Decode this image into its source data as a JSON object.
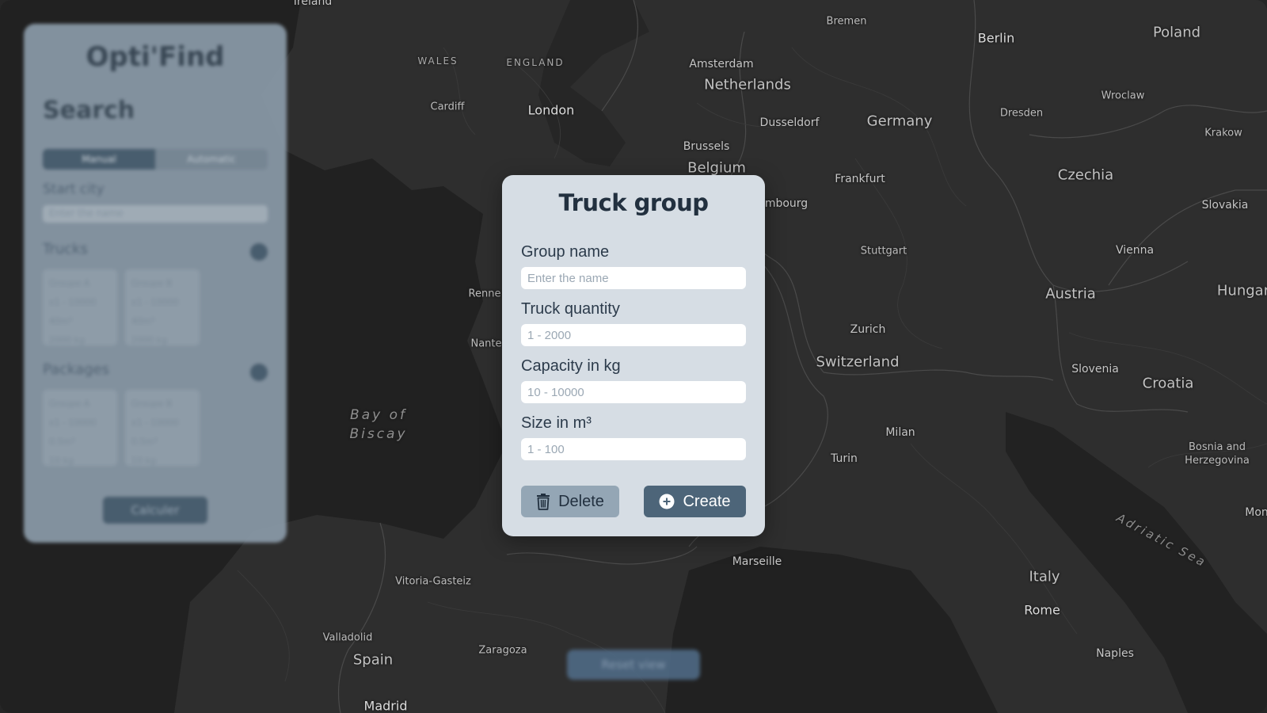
{
  "colors": {
    "map_background": "#2b2b2b",
    "modal_background": "#d6dde4",
    "primary_button": "#4d6579",
    "secondary_button": "#94a6b5",
    "title_text": "#22303f"
  },
  "map": {
    "labels": {
      "ireland": "Ireland",
      "wales": "WALES",
      "england": "ENGLAND",
      "cardiff": "Cardiff",
      "london": "London",
      "amsterdam": "Amsterdam",
      "netherlands": "Netherlands",
      "bremen": "Bremen",
      "berlin": "Berlin",
      "poland": "Poland",
      "wroclaw": "Wroclaw",
      "dresden": "Dresden",
      "krakow": "Krakow",
      "dusseldorf": "Dusseldorf",
      "germany": "Germany",
      "brussels": "Brussels",
      "belgium": "Belgium",
      "frankfurt": "Frankfurt",
      "luxembourg_partial": "mbourg",
      "czechia": "Czechia",
      "slovakia": "Slovakia",
      "stuttgart": "Stuttgart",
      "vienna": "Vienna",
      "hungary_partial": "Hungar",
      "rennes_partial": "Renne",
      "austria": "Austria",
      "zurich": "Zurich",
      "nantes_partial": "Nante",
      "switzerland": "Switzerland",
      "slovenia": "Slovenia",
      "croatia": "Croatia",
      "bay_of_biscay": "Bay of Biscay",
      "milan": "Milan",
      "bosnia": "Bosnia and Herzegovina",
      "turin": "Turin",
      "montenegro_partial": "Mon",
      "adriatic_sea": "Adriatic Sea",
      "marseille": "Marseille",
      "vitoria": "Vitoria-Gasteiz",
      "italy": "Italy",
      "rome": "Rome",
      "valladolid": "Valladolid",
      "spain": "Spain",
      "zaragoza": "Zaragoza",
      "naples": "Naples",
      "madrid": "Madrid"
    }
  },
  "side_panel": {
    "brand": "Opti'Find",
    "heading": "Search",
    "tabs": [
      "Manual",
      "Automatic"
    ],
    "start_city_label": "Start city",
    "start_city_placeholder": "Enter the name",
    "trucks_label": "Trucks",
    "truck_cards": [
      [
        "Groupe A",
        "x1 - 10000",
        "40m³",
        "2000 kg"
      ],
      [
        "Groupe B",
        "x1 - 10000",
        "40m³",
        "2000 kg"
      ]
    ],
    "packages_label": "Packages",
    "package_cards": [
      [
        "Groupe A",
        "x1 - 10000",
        "0.5m³",
        "10 kg"
      ],
      [
        "Groupe B",
        "x1 - 10000",
        "0.5m³",
        "10 kg"
      ]
    ],
    "calculate_label": "Calculer"
  },
  "reset_view_label": "Reset view",
  "modal": {
    "title": "Truck group",
    "fields": [
      {
        "label": "Group name",
        "placeholder": "Enter the name",
        "value": ""
      },
      {
        "label": "Truck quantity",
        "placeholder": "1 - 2000",
        "value": ""
      },
      {
        "label": "Capacity in kg",
        "placeholder": "10 - 10000",
        "value": ""
      },
      {
        "label": "Size in m³",
        "placeholder": "1 - 100",
        "value": ""
      }
    ],
    "delete_label": "Delete",
    "create_label": "Create",
    "delete_icon": "trash-icon",
    "create_icon": "plus-circle-icon"
  }
}
